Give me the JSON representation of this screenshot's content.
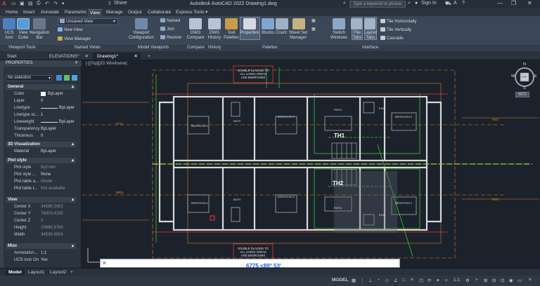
{
  "title_bar": {
    "app_letter": "A",
    "share_label": "Share",
    "title": "Autodesk AutoCAD 2022   Drawing1.dwg",
    "search_placeholder": "Type a keyword or phrase",
    "sign_in_label": "Sign In"
  },
  "menu_tabs": [
    {
      "label": "Home"
    },
    {
      "label": "Insert"
    },
    {
      "label": "Annotate"
    },
    {
      "label": "Parametric"
    },
    {
      "label": "View"
    },
    {
      "label": "Manage"
    },
    {
      "label": "Output"
    },
    {
      "label": "Collaborate"
    },
    {
      "label": "Express Tools"
    }
  ],
  "ribbon": {
    "ucs_icon": "UCS Icon",
    "view_cube": "View Cube",
    "navigation_bar": "Navigation Bar",
    "unsaved_view": "Unsaved View",
    "new_view": "New View",
    "view_manager": "View Manager",
    "viewport_configuration": "Viewport Configuration",
    "named": "Named",
    "join": "Join",
    "restore": "Restore",
    "dwg_compare": "DWG Compare",
    "dwg_history": "DWG History",
    "tool_palettes": "Tool Palettes",
    "properties": "Properties",
    "blocks": "Blocks",
    "count": "Count",
    "sheet_set_manager": "Sheet Set Manager",
    "switch_windows": "Switch Windows",
    "file_tabs": "File Tabs",
    "layout_tabs": "Layout Tabs",
    "tile_horizontally": "Tile Horizontally",
    "tile_vertically": "Tile Vertically",
    "cascade": "Cascade"
  },
  "panel_titles": {
    "viewport_tools": "Viewport Tools",
    "named_views": "Named Views",
    "model_viewports": "Model Viewports",
    "compare": "Compare",
    "history": "History",
    "palettes": "Palettes",
    "interface": "Interface"
  },
  "doc_tabs": [
    {
      "label": "Start"
    },
    {
      "label": "ELEVATIONS*"
    },
    {
      "label": "Drawing1*"
    }
  ],
  "viewport_label": "[-][Top][2D Wireframe]",
  "properties": {
    "header": "PROPERTIES",
    "selection": "No selection",
    "sections": {
      "general": "General",
      "viz3d": "3D Visualization",
      "plot": "Plot style",
      "view": "View",
      "misc": "Misc"
    },
    "general": [
      {
        "key": "Color",
        "value": "ByLayer"
      },
      {
        "key": "Layer",
        "value": "0"
      },
      {
        "key": "Linetype",
        "value": "ByLayer"
      },
      {
        "key": "Linetype sc...",
        "value": "1"
      },
      {
        "key": "Lineweight",
        "value": "ByLayer"
      },
      {
        "key": "Transparency",
        "value": "ByLayer"
      },
      {
        "key": "Thickness",
        "value": "0"
      }
    ],
    "viz3d": [
      {
        "key": "Material",
        "value": "ByLayer"
      }
    ],
    "plot": [
      {
        "key": "Plot style",
        "value": "ByColor"
      },
      {
        "key": "Plot style ...",
        "value": "None"
      },
      {
        "key": "Plot table a...",
        "value": "Model"
      },
      {
        "key": "Plot table t...",
        "value": "Not available"
      }
    ],
    "view": [
      {
        "key": "Center X",
        "value": "34586.3063"
      },
      {
        "key": "Center Y",
        "value": "78003.4295"
      },
      {
        "key": "Center Z",
        "value": "0"
      },
      {
        "key": "Height",
        "value": "15688.9769"
      },
      {
        "key": "Width",
        "value": "34536.9504"
      }
    ],
    "misc": [
      {
        "key": "Annotation...",
        "value": "1:1"
      },
      {
        "key": "UCS icon On",
        "value": "Yes"
      }
    ]
  },
  "drawing": {
    "note_top": [
      "DOUBLE GLAZING TO",
      "ALL LIVING AREAS",
      "AND BEDROOMS"
    ],
    "note_bottom": [
      "DOUBLE GLAZING TO",
      "ALL LIVING AREAS",
      "AND BEDROOMS"
    ],
    "th1": "TH1",
    "th2": "TH2",
    "rooms_top": [
      "BEDROOM 4",
      "BATH",
      "BEDROOM 3",
      "PATIO",
      "BEDROOM 2",
      "ENS"
    ],
    "rooms_bottom": [
      "BEDROOM 4",
      "BATH",
      "BEDROOM 3",
      "PATIO",
      "BEDROOM 2",
      "ENS"
    ],
    "dims": [
      "8731",
      "8805",
      "7542",
      "7805"
    ],
    "command_text": "6775 <89° 53'"
  },
  "compass": {
    "n": "N",
    "s": "S",
    "e": "E",
    "w": "W",
    "top": "TOP",
    "wcs": "WCS"
  },
  "layout_tabs": [
    {
      "label": "Model"
    },
    {
      "label": "Layout1"
    },
    {
      "label": "Layout2"
    }
  ],
  "status": {
    "model": "MODEL",
    "scale": "1:1"
  },
  "colors": {
    "ribbon_bg": "#3b4656",
    "canvas_bg": "#1c222b",
    "wall": "#d8d8d8",
    "green": "#35c435",
    "orange": "#d9822b",
    "red": "#e03a3a",
    "yellow": "#d8d040"
  }
}
